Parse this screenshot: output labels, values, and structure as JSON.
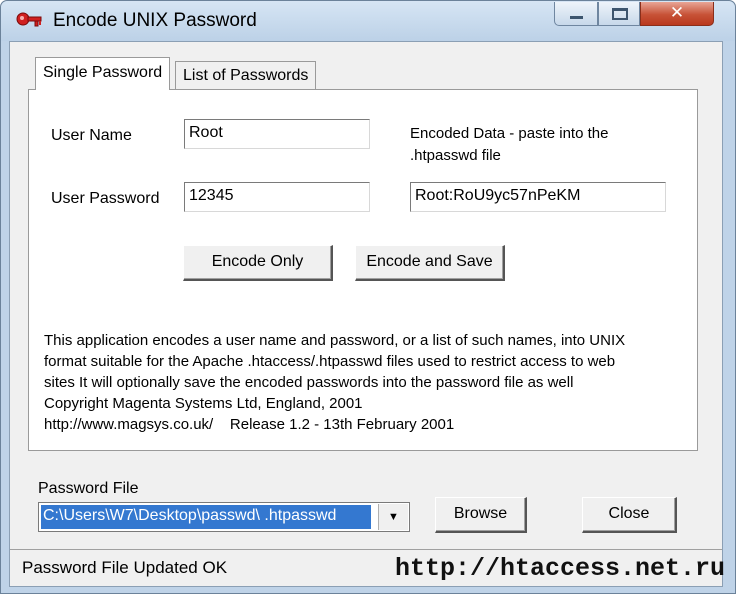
{
  "window": {
    "title": "Encode UNIX Password",
    "close_glyph": "✕"
  },
  "tabs": [
    {
      "label": "Single Password",
      "active": true
    },
    {
      "label": "List of Passwords",
      "active": false
    }
  ],
  "form": {
    "user_name_label": "User Name",
    "user_name_value": "Root",
    "user_password_label": "User Password",
    "user_password_value": "12345",
    "encoded_label_line1": "Encoded Data - paste into the",
    "encoded_label_line2": ".htpasswd file",
    "encoded_value": "Root:RoU9yc57nPeKM"
  },
  "buttons": {
    "encode_only": "Encode Only",
    "encode_and_save": "Encode and Save",
    "browse": "Browse",
    "close": "Close"
  },
  "description": {
    "line1": "This application encodes a user name and password, or a list of such names, into UNIX",
    "line2": "format suitable for the Apache .htaccess/.htpasswd files used to restrict access to web",
    "line3": "sites It will optionally save the encoded passwords into the password file as well",
    "line4": "Copyright Magenta Systems Ltd, England, 2001",
    "line5": "http://www.magsys.co.uk/    Release 1.2 - 13th February 2001"
  },
  "password_file": {
    "label": "Password File",
    "value": "C:\\Users\\W7\\Desktop\\passwd\\ .htpasswd",
    "arrow": "▼"
  },
  "status": {
    "text": "Password File Updated OK",
    "watermark": "http://htaccess.net.ru"
  },
  "colors": {
    "selection": "#3478d0",
    "close_button": "#c75237",
    "titlebar": "#bcd1e7"
  },
  "icons": [
    "key-icon",
    "minimize-icon",
    "maximize-icon",
    "close-icon",
    "dropdown-arrow-icon"
  ]
}
